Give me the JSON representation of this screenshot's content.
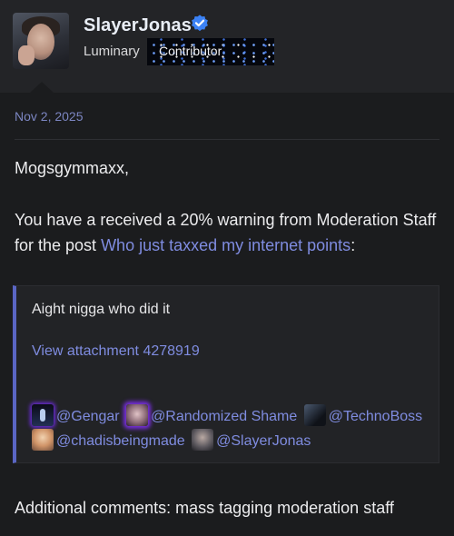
{
  "header": {
    "username": "SlayerJonas",
    "rank": "Luminary",
    "banner": "Contributor"
  },
  "post": {
    "date": "Nov 2, 2025",
    "greeting": "Mogsgymmaxx,",
    "body_prefix": "You have a received a 20% warning from Moderation Staff for the post ",
    "post_link": "Who just taxxed my internet points",
    "body_suffix": ":",
    "quote": {
      "text": "Aight nigga who did it",
      "attachment": "View attachment 4278919",
      "mentions": [
        "@Gengar",
        "@Randomized Shame",
        "@TechnoBoss",
        "@chadisbeingmade",
        "@SlayerJonas"
      ]
    },
    "additional": "Additional comments: mass tagging moderation staff"
  },
  "colors": {
    "accent": "#7f8ce0",
    "quote_bar": "#5a66c4",
    "verified": "#3b82f6"
  }
}
